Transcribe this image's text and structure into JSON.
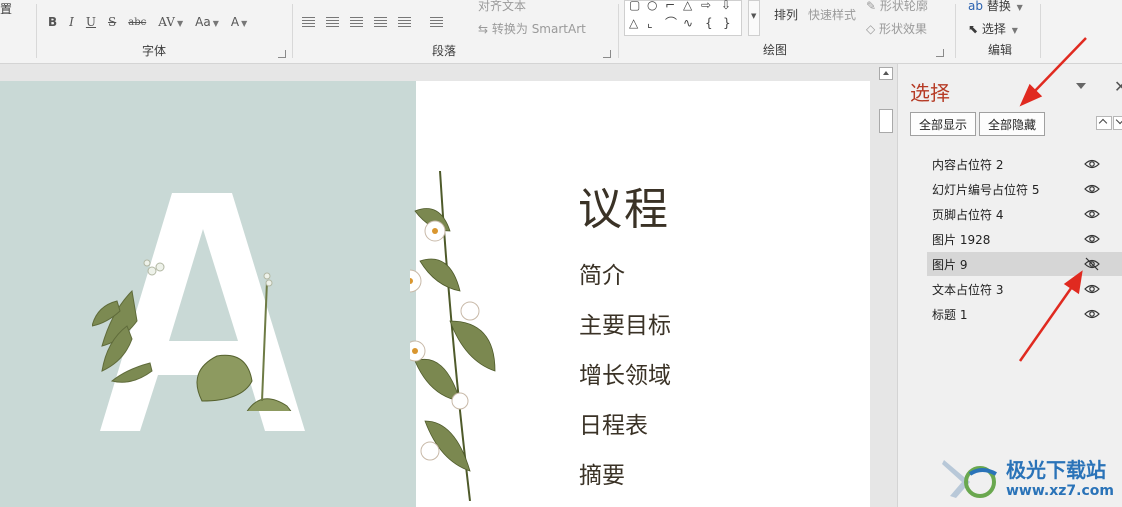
{
  "ribbon": {
    "font_group_label": "字体",
    "paragraph_group_label": "段落",
    "drawing_group_label": "绘图",
    "editing_group_label": "编辑",
    "align_text_label": "对齐文本",
    "convert_smartart_label": "转换为 SmartArt",
    "arrange_label": "排列",
    "quick_styles_label": "快速样式",
    "shape_outline_label": "形状轮廓",
    "shape_effects_label": "形状效果",
    "replace_label": "替换",
    "select_label": "选择",
    "font_size_case_label": "Aa",
    "font_char_spacing_label": "AV",
    "font_color_label": "A",
    "truncated_left_label": "置"
  },
  "slide": {
    "big_letter": "A",
    "title": "议程",
    "agenda": [
      "简介",
      "主要目标",
      "增长领域",
      "日程表",
      "摘要"
    ]
  },
  "pane": {
    "title": "选择",
    "show_all_label": "全部显示",
    "hide_all_label": "全部隐藏",
    "items": [
      {
        "label": "内容占位符 2",
        "visible": true
      },
      {
        "label": "幻灯片编号占位符 5",
        "visible": true
      },
      {
        "label": "页脚占位符 4",
        "visible": true
      },
      {
        "label": "图片 1928",
        "visible": true
      },
      {
        "label": "图片 9",
        "visible": false
      },
      {
        "label": "文本占位符 3",
        "visible": true
      },
      {
        "label": "标题 1",
        "visible": true
      }
    ]
  },
  "watermark": {
    "name": "极光下载站",
    "url": "www.xz7.com"
  },
  "colors": {
    "pane_title": "#b63b25",
    "slide_panel": "#c9d9d6",
    "annotation_arrow": "#e02a20"
  }
}
